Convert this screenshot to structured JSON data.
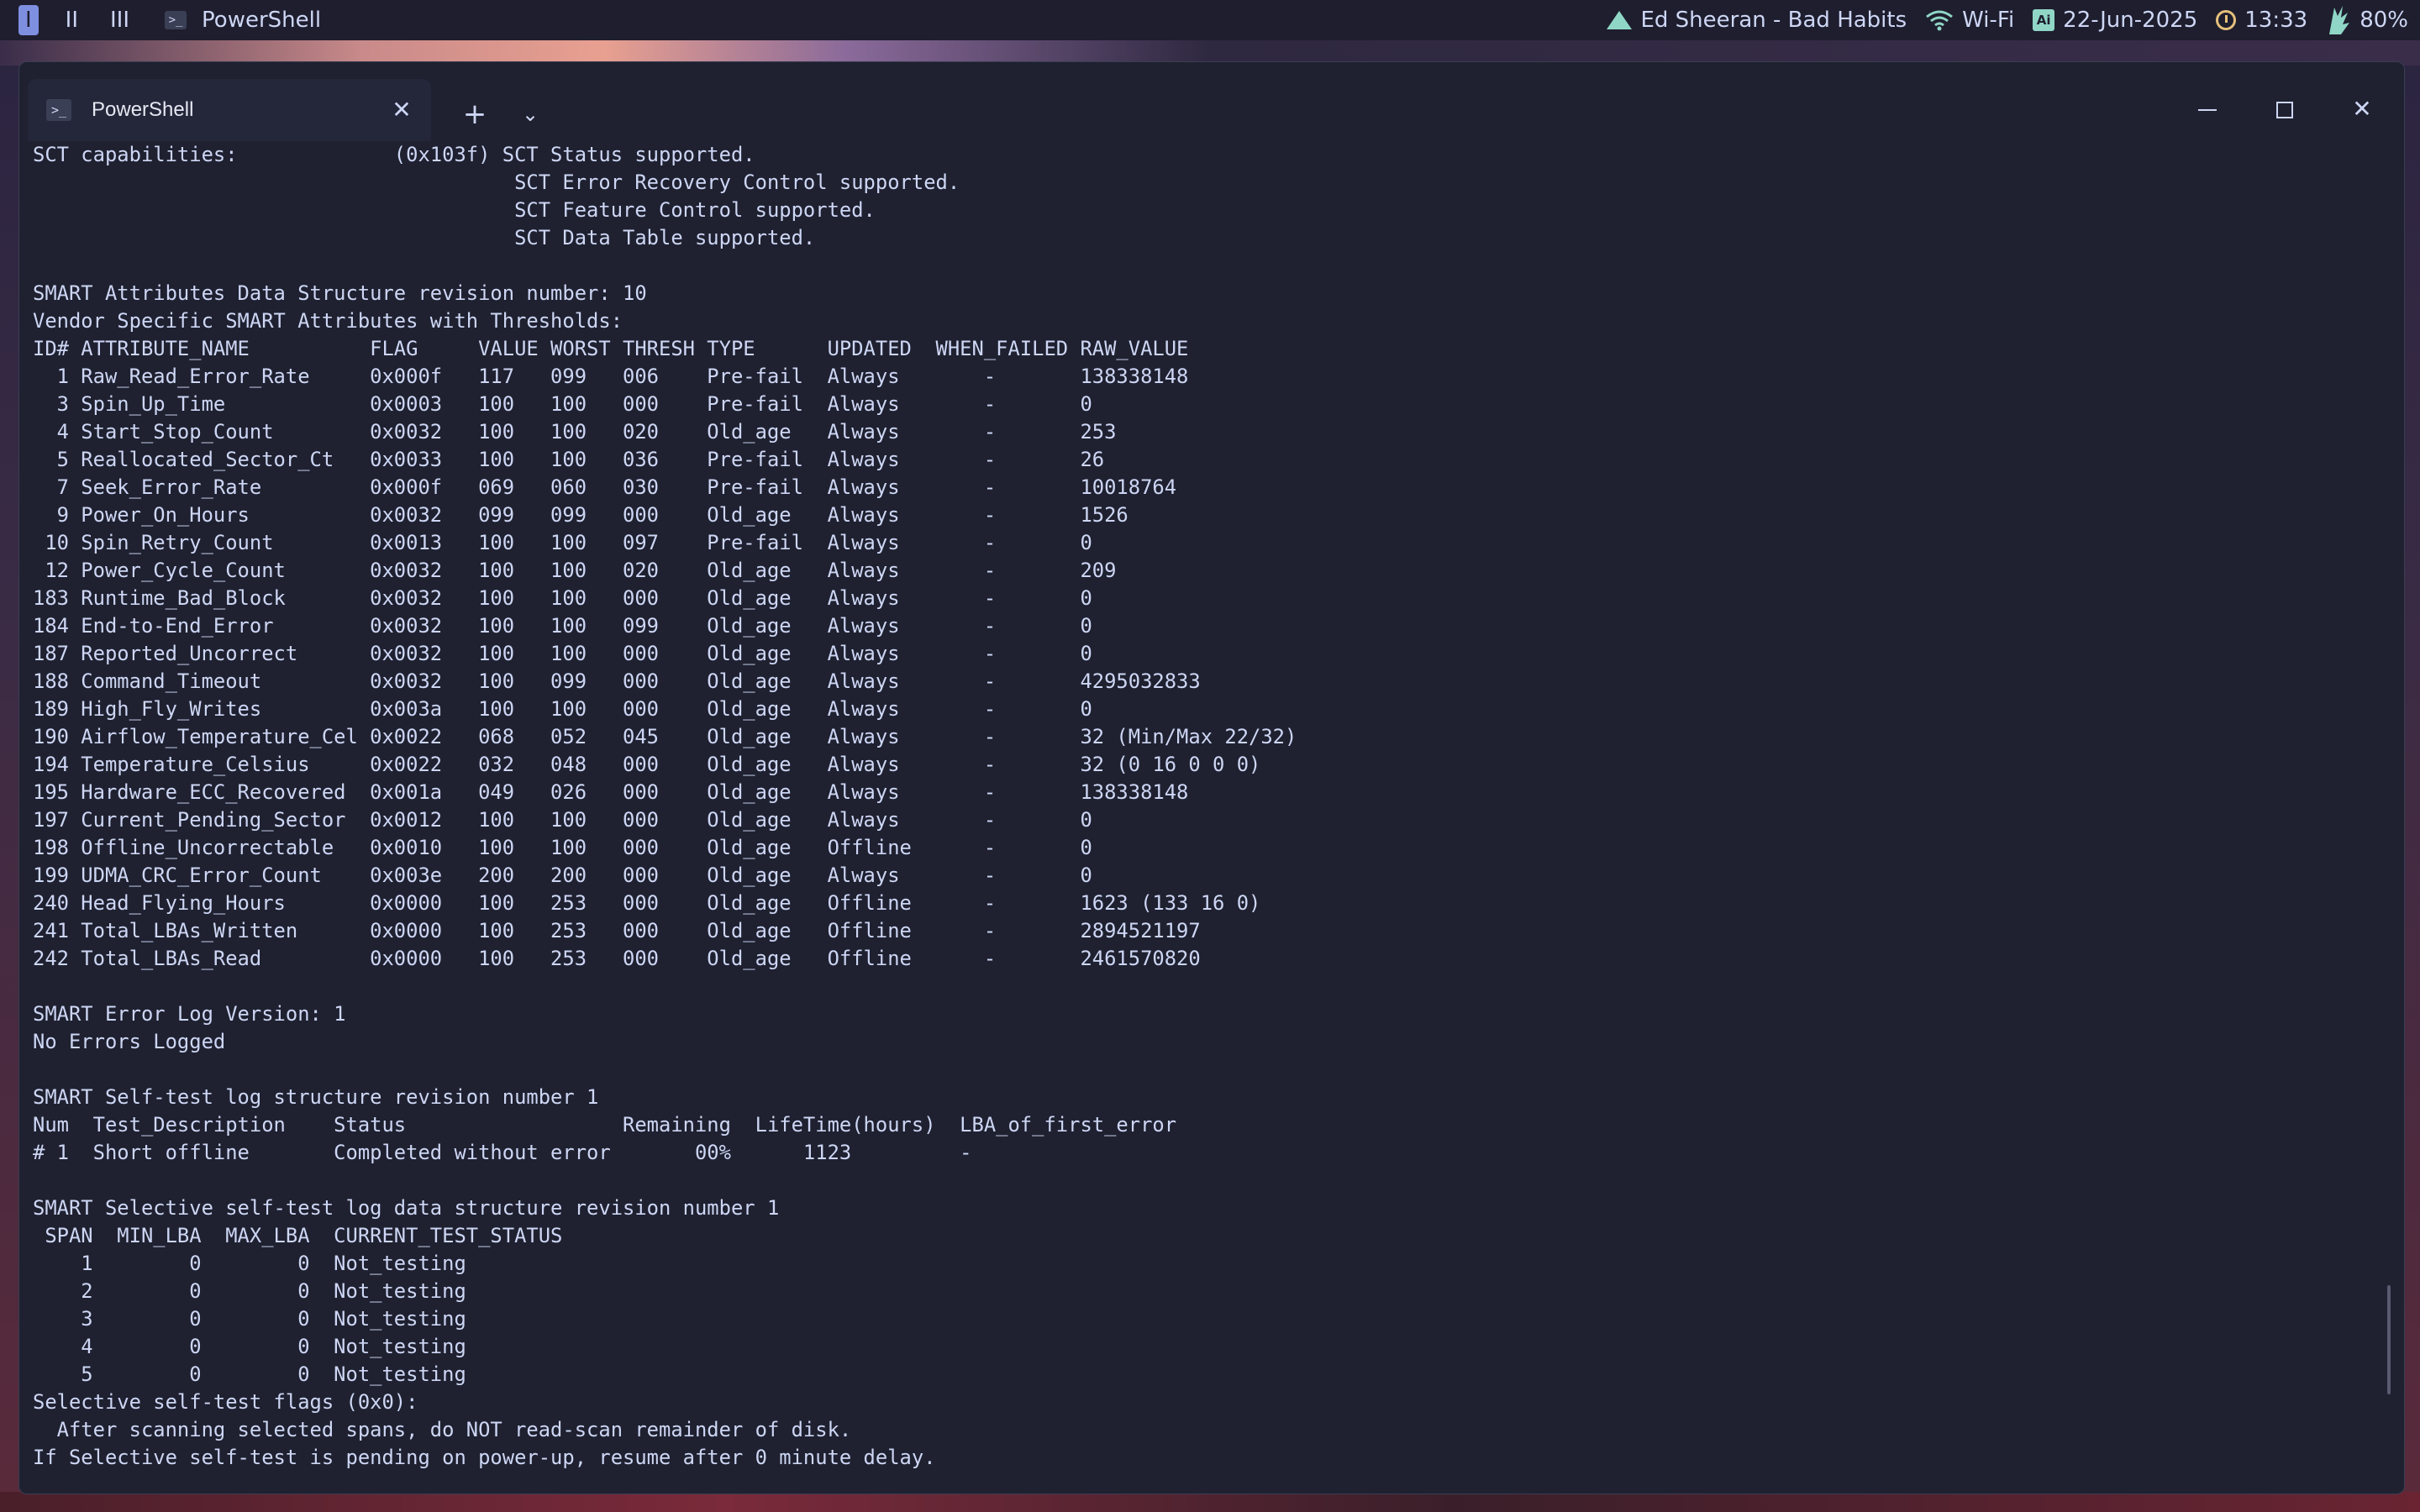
{
  "topbar": {
    "workspaces": [
      "I",
      "II",
      "III"
    ],
    "active_workspace": "I",
    "app_icon": "powershell-icon",
    "app_title": "PowerShell",
    "media": "Ed Sheeran - Bad Habits",
    "network": "Wi-Fi",
    "date": "22-Jun-2025",
    "time": "13:33",
    "battery": "80%",
    "accent_color": "#7f8fe0"
  },
  "window": {
    "tab_title": "PowerShell",
    "tab_icon": "powershell-icon",
    "new_tab": "+",
    "dropdown": "⌄",
    "close_tab": "✕",
    "close_window": "✕"
  },
  "terminal": {
    "background": "#1f2130",
    "foreground": "#cdd6f4",
    "lines": [
      "SCT capabilities:             (0x103f) SCT Status supported.",
      "                                        SCT Error Recovery Control supported.",
      "                                        SCT Feature Control supported.",
      "                                        SCT Data Table supported.",
      "",
      "SMART Attributes Data Structure revision number: 10",
      "Vendor Specific SMART Attributes with Thresholds:",
      "ID# ATTRIBUTE_NAME          FLAG     VALUE WORST THRESH TYPE      UPDATED  WHEN_FAILED RAW_VALUE",
      "  1 Raw_Read_Error_Rate     0x000f   117   099   006    Pre-fail  Always       -       138338148",
      "  3 Spin_Up_Time            0x0003   100   100   000    Pre-fail  Always       -       0",
      "  4 Start_Stop_Count        0x0032   100   100   020    Old_age   Always       -       253",
      "  5 Reallocated_Sector_Ct   0x0033   100   100   036    Pre-fail  Always       -       26",
      "  7 Seek_Error_Rate         0x000f   069   060   030    Pre-fail  Always       -       10018764",
      "  9 Power_On_Hours          0x0032   099   099   000    Old_age   Always       -       1526",
      " 10 Spin_Retry_Count        0x0013   100   100   097    Pre-fail  Always       -       0",
      " 12 Power_Cycle_Count       0x0032   100   100   020    Old_age   Always       -       209",
      "183 Runtime_Bad_Block       0x0032   100   100   000    Old_age   Always       -       0",
      "184 End-to-End_Error        0x0032   100   100   099    Old_age   Always       -       0",
      "187 Reported_Uncorrect      0x0032   100   100   000    Old_age   Always       -       0",
      "188 Command_Timeout         0x0032   100   099   000    Old_age   Always       -       4295032833",
      "189 High_Fly_Writes         0x003a   100   100   000    Old_age   Always       -       0",
      "190 Airflow_Temperature_Cel 0x0022   068   052   045    Old_age   Always       -       32 (Min/Max 22/32)",
      "194 Temperature_Celsius     0x0022   032   048   000    Old_age   Always       -       32 (0 16 0 0 0)",
      "195 Hardware_ECC_Recovered  0x001a   049   026   000    Old_age   Always       -       138338148",
      "197 Current_Pending_Sector  0x0012   100   100   000    Old_age   Always       -       0",
      "198 Offline_Uncorrectable   0x0010   100   100   000    Old_age   Offline      -       0",
      "199 UDMA_CRC_Error_Count    0x003e   200   200   000    Old_age   Always       -       0",
      "240 Head_Flying_Hours       0x0000   100   253   000    Old_age   Offline      -       1623 (133 16 0)",
      "241 Total_LBAs_Written      0x0000   100   253   000    Old_age   Offline      -       2894521197",
      "242 Total_LBAs_Read         0x0000   100   253   000    Old_age   Offline      -       2461570820",
      "",
      "SMART Error Log Version: 1",
      "No Errors Logged",
      "",
      "SMART Self-test log structure revision number 1",
      "Num  Test_Description    Status                  Remaining  LifeTime(hours)  LBA_of_first_error",
      "# 1  Short offline       Completed without error       00%      1123         -",
      "",
      "SMART Selective self-test log data structure revision number 1",
      " SPAN  MIN_LBA  MAX_LBA  CURRENT_TEST_STATUS",
      "    1        0        0  Not_testing",
      "    2        0        0  Not_testing",
      "    3        0        0  Not_testing",
      "    4        0        0  Not_testing",
      "    5        0        0  Not_testing",
      "Selective self-test flags (0x0):",
      "  After scanning selected spans, do NOT read-scan remainder of disk.",
      "If Selective self-test is pending on power-up, resume after 0 minute delay."
    ]
  }
}
